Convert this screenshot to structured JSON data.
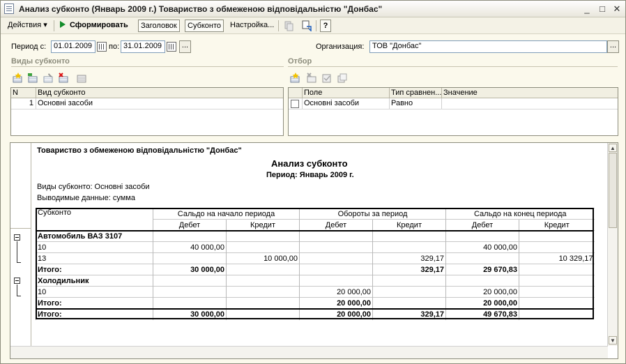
{
  "window": {
    "title": "Анализ субконто (Январь 2009 г.) Товариство з обмеженою відповідальністю \"Донбас\"",
    "minimize": "_",
    "maximize": "□",
    "close": "✕"
  },
  "toolbar": {
    "actions": "Действия ▾",
    "generate": "Сформировать",
    "header": "Заголовок",
    "subconto": "Субконто",
    "settings": "Настройка...",
    "help": "?"
  },
  "form": {
    "period_from_label": "Период с:",
    "period_from": "01.01.2009",
    "period_to_label": "по:",
    "period_to": "31.01.2009",
    "dots": "...",
    "organization_label": "Организация:",
    "organization": "ТОВ \"Донбас\""
  },
  "subconto_types": {
    "title": "Виды субконто",
    "columns": [
      "N",
      "Вид субконто"
    ],
    "rows": [
      {
        "n": "1",
        "name": "Основні засоби"
      }
    ]
  },
  "filter": {
    "title": "Отбор",
    "columns": [
      "Поле",
      "Тип сравнен...",
      "Значение"
    ],
    "rows": [
      {
        "field": "Основні засоби",
        "compare": "Равно",
        "value": ""
      }
    ]
  },
  "report": {
    "company": "Товариство з обмеженою відповідальністю \"Донбас\"",
    "title": "Анализ субконто",
    "period": "Период: Январь 2009 г.",
    "types_line": "Виды субконто: Основні засоби",
    "output_line": "Выводимые данные: сумма",
    "headers": {
      "subconto": "Субконто",
      "start": "Сальдо на начало периода",
      "turnover": "Обороты за период",
      "end": "Сальдо на конец периода",
      "debit": "Дебет",
      "credit": "Кредит"
    },
    "rows": [
      {
        "label": "Автомобиль ВАЗ 3107",
        "bold": true,
        "v": [
          "",
          "",
          "",
          "",
          "",
          ""
        ]
      },
      {
        "label": "10",
        "bold": false,
        "v": [
          "40 000,00",
          "",
          "",
          "",
          "40 000,00",
          ""
        ]
      },
      {
        "label": "13",
        "bold": false,
        "v": [
          "",
          "10 000,00",
          "",
          "329,17",
          "",
          "10 329,17"
        ]
      },
      {
        "label": "Итого:",
        "bold": true,
        "v": [
          "30 000,00",
          "",
          "",
          "329,17",
          "29 670,83",
          ""
        ]
      },
      {
        "label": "Холодильник",
        "bold": true,
        "v": [
          "",
          "",
          "",
          "",
          "",
          ""
        ]
      },
      {
        "label": "10",
        "bold": false,
        "v": [
          "",
          "",
          "20 000,00",
          "",
          "20 000,00",
          ""
        ]
      },
      {
        "label": "Итого:",
        "bold": true,
        "v": [
          "",
          "",
          "20 000,00",
          "",
          "20 000,00",
          ""
        ]
      },
      {
        "label": "Итого:",
        "bold": true,
        "v": [
          "30 000,00",
          "",
          "20 000,00",
          "329,17",
          "49 670,83",
          ""
        ]
      }
    ]
  },
  "icons": {
    "window": "document-icon",
    "play": "play-icon",
    "calendar": "calendar-icon"
  }
}
